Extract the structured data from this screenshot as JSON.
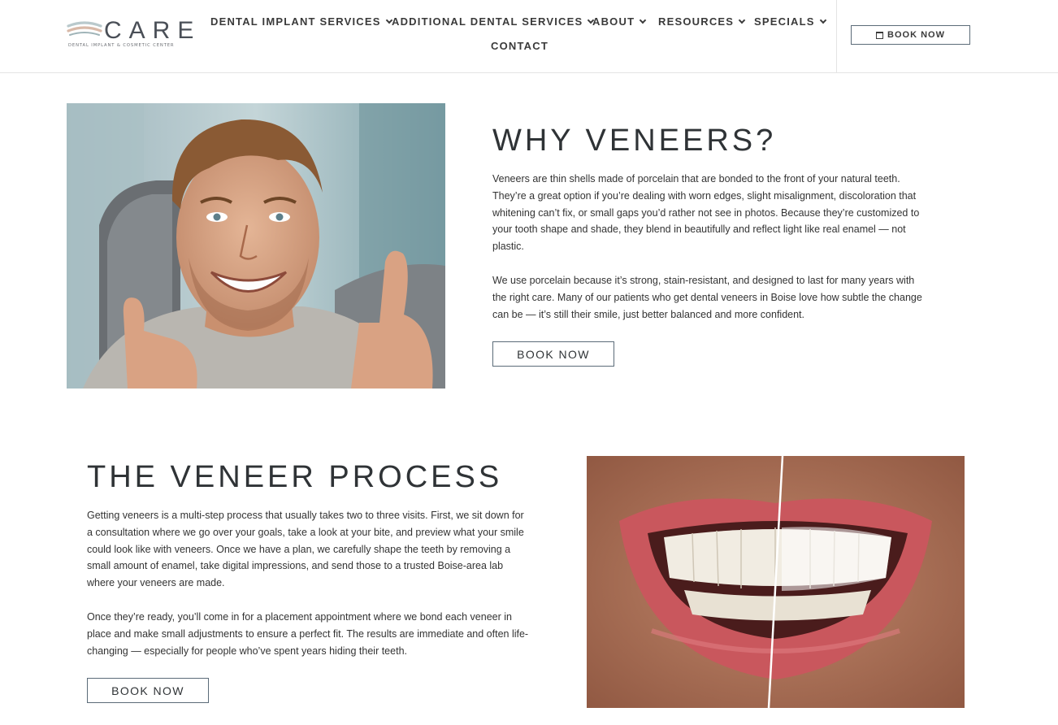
{
  "logo": {
    "word": "CARE",
    "tagline": "DENTAL IMPLANT & COSMETIC CENTER"
  },
  "nav": {
    "items": [
      {
        "label": "DENTAL IMPLANT SERVICES"
      },
      {
        "label": "ADDITIONAL DENTAL SERVICES"
      },
      {
        "label": "ABOUT"
      },
      {
        "label": "RESOURCES"
      },
      {
        "label": "SPECIALS"
      }
    ],
    "contact": "CONTACT",
    "book_label": "BOOK NOW"
  },
  "why": {
    "heading": "WHY VENEERS?",
    "para1": "Veneers are thin shells made of porcelain that are bonded to the front of your natural teeth. They’re a great option if you’re dealing with worn edges, slight misalignment, discoloration that whitening can’t fix, or small gaps you’d rather not see in photos. Because they’re customized to your tooth shape and shade, they blend in beautifully and reflect light like real enamel — not plastic.",
    "para2": "We use porcelain because it’s strong, stain-resistant, and designed to last for many years with the right care. Many of our patients who get dental veneers in Boise love how subtle the change can be — it’s still their smile, just better balanced and more confident.",
    "button": "BOOK NOW"
  },
  "process": {
    "heading": "THE VENEER PROCESS",
    "para1": "Getting veneers is a multi-step process that usually takes two to three visits. First, we sit down for a consultation where we go over your goals, take a look at your bite, and preview what your smile could look like with veneers. Once we have a plan, we carefully shape the teeth by removing a small amount of enamel, take digital impressions, and send those to a trusted Boise-area lab where your veneers are made.",
    "para2": "Once they’re ready, you’ll come in for a placement appointment where we bond each veneer in place and make small adjustments to ensure a perfect fit. The results are immediate and often life-changing — especially for people who’ve spent years hiding their teeth.",
    "button": "BOOK NOW"
  },
  "colors": {
    "text": "#333333",
    "heading": "#2f3336",
    "button_border": "#5b6b78",
    "logo_swoosh_top": "#b9c9cc",
    "logo_swoosh_bottom": "#d8b9a8"
  }
}
